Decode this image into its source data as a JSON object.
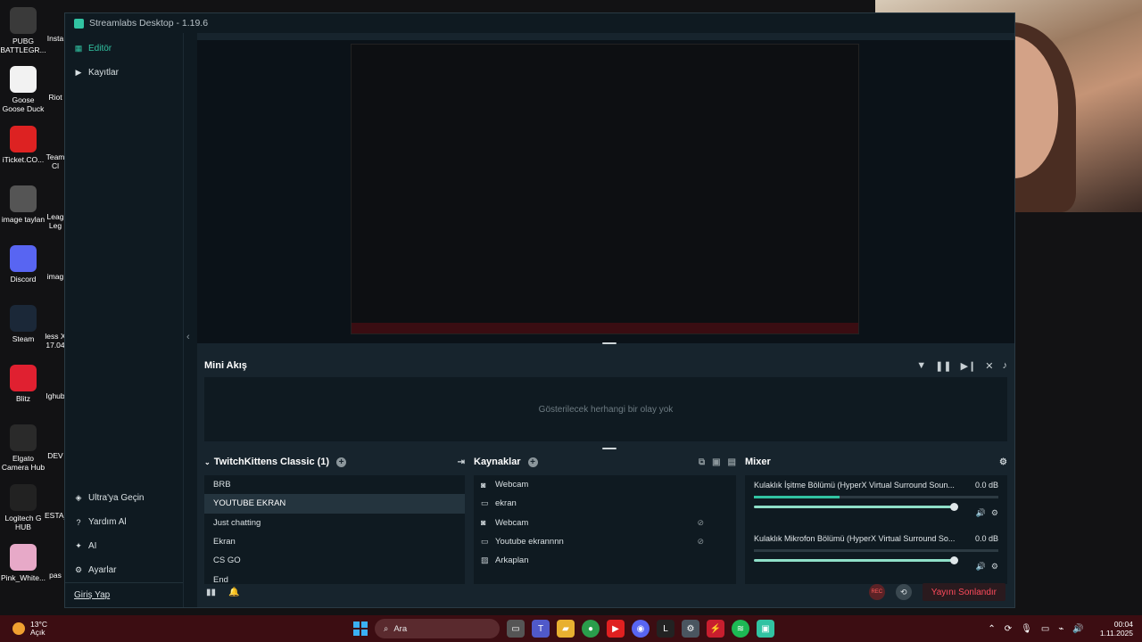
{
  "desktop_icons": [
    {
      "label": "PUBG BATTLEGR...",
      "icon": "pubg-icon",
      "color": "#3a3a3a"
    },
    {
      "label": "Goose Goose Duck",
      "icon": "goose-icon",
      "color": "#f2f2f2"
    },
    {
      "label": "iTicket.CO...",
      "icon": "pdf-icon",
      "color": "#d22"
    },
    {
      "label": "image taylan",
      "icon": "image-icon",
      "color": "#555"
    },
    {
      "label": "Discord",
      "icon": "discord-icon",
      "color": "#5865f2"
    },
    {
      "label": "Steam",
      "icon": "steam-icon",
      "color": "#1b2838"
    },
    {
      "label": "Blitz",
      "icon": "blitz-icon",
      "color": "#e02030"
    },
    {
      "label": "Elgato Camera Hub",
      "icon": "elgato-icon",
      "color": "#2a2a2a"
    },
    {
      "label": "Logitech G HUB",
      "icon": "logitech-icon",
      "color": "#222"
    },
    {
      "label": "Pink_White...",
      "icon": "image-icon",
      "color": "#e7a9c8"
    }
  ],
  "desktop_icons_col2": [
    {
      "label": "Insta"
    },
    {
      "label": "Riot"
    },
    {
      "label": "Team Cl"
    },
    {
      "label": "Leag Leg"
    },
    {
      "label": "imag"
    },
    {
      "label": "less X 17.04"
    },
    {
      "label": "Ighub"
    },
    {
      "label": "DEV"
    },
    {
      "label": "ESTA_"
    },
    {
      "label": "pas"
    }
  ],
  "window": {
    "title": "Streamlabs Desktop - 1.19.6"
  },
  "sidebar": {
    "items": [
      {
        "label": "Editör",
        "icon": "editor-icon"
      },
      {
        "label": "Kayıtlar",
        "icon": "recordings-icon"
      }
    ],
    "bottom_items": [
      {
        "label": "Ultra'ya Geçin",
        "icon": "ultra-icon"
      },
      {
        "label": "Yardım Al",
        "icon": "help-icon"
      },
      {
        "label": "AI",
        "icon": "ai-icon"
      },
      {
        "label": "Ayarlar",
        "icon": "settings-icon"
      }
    ],
    "login": "Giriş Yap"
  },
  "mini_feed": {
    "title": "Mini Akış",
    "empty_text": "Gösterilecek herhangi bir olay yok"
  },
  "scenes": {
    "title": "TwitchKittens Classic (1)",
    "items": [
      "BRB",
      "YOUTUBE EKRAN",
      "Just chatting",
      "Ekran",
      "CS GO",
      "End"
    ],
    "selected_index": 1
  },
  "sources": {
    "title": "Kaynaklar",
    "items": [
      {
        "label": "Webcam",
        "icon": "webcam-icon",
        "hidden": false
      },
      {
        "label": "ekran",
        "icon": "monitor-icon",
        "hidden": false
      },
      {
        "label": "Webcam",
        "icon": "webcam-icon",
        "hidden": true
      },
      {
        "label": "Youtube ekrannnn",
        "icon": "monitor-icon",
        "hidden": true
      },
      {
        "label": "Arkaplan",
        "icon": "image-icon",
        "hidden": false
      }
    ]
  },
  "mixer": {
    "title": "Mixer",
    "channels": [
      {
        "name": "Kulaklık İşitme Bölümü (HyperX Virtual Surround Soun...",
        "db": "0.0 dB",
        "level": 0.35
      },
      {
        "name": "Kulaklık Mikrofon Bölümü (HyperX Virtual Surround So...",
        "db": "0.0 dB",
        "level": 0.0
      }
    ]
  },
  "footer": {
    "rec_label": "REC",
    "end_stream": "Yayını Sonlandır"
  },
  "taskbar": {
    "weather_temp": "13°C",
    "weather_desc": "Açık",
    "search_placeholder": "Ara",
    "time": "00:04",
    "date": "1.11.2025"
  },
  "colors": {
    "accent": "#31c3a2",
    "danger": "#ff4b5c",
    "taskbar": "#3c0d12"
  }
}
